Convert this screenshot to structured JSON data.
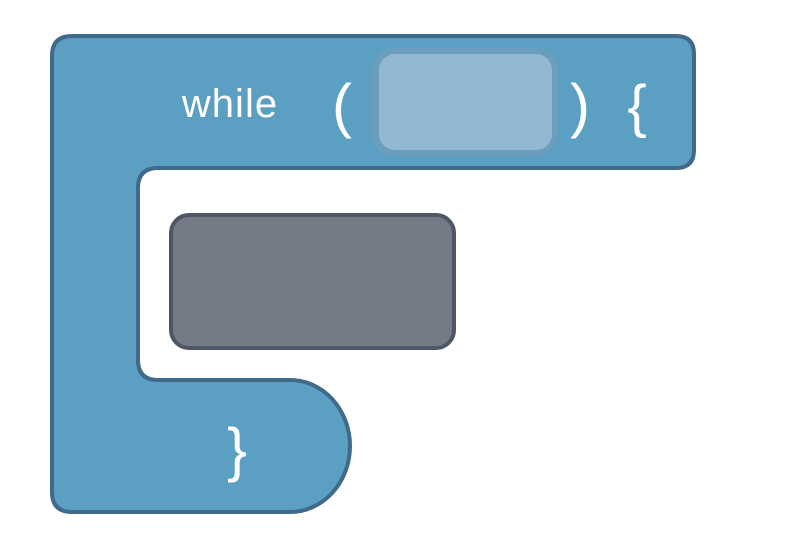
{
  "block": {
    "keyword": "while",
    "open_paren": "(",
    "close_paren": ")",
    "open_brace": "{",
    "close_brace": "}"
  },
  "colors": {
    "block_fill": "#5B9FC2",
    "block_stroke": "#40698A",
    "condition_slot_fill": "#93B8D1",
    "condition_slot_stroke": "#6F9DBC",
    "body_slot_fill": "#737B86",
    "body_slot_stroke": "#4F5766",
    "text": "#FFFFFF"
  }
}
